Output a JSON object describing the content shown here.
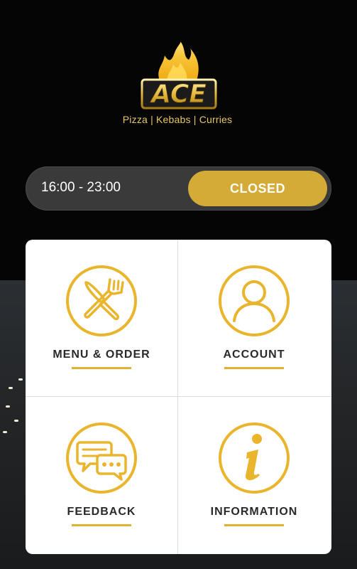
{
  "brand": {
    "logo_text": "ACE",
    "tagline": "Pizza | Kebabs | Curries",
    "accent_color": "#e0b22f"
  },
  "hours": {
    "time_range": "16:00 - 23:00",
    "status_label": "CLOSED"
  },
  "tiles": [
    {
      "label": "MENU & ORDER",
      "icon": "knife-fork-icon"
    },
    {
      "label": "ACCOUNT",
      "icon": "user-icon"
    },
    {
      "label": "FEEDBACK",
      "icon": "chat-bubbles-icon"
    },
    {
      "label": "INFORMATION",
      "icon": "info-icon"
    }
  ]
}
